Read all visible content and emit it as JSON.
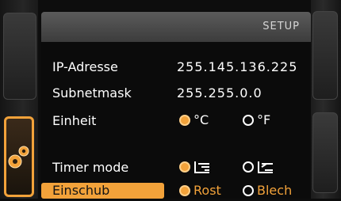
{
  "header": {
    "title": "SETUP"
  },
  "settings": {
    "ip": {
      "label": "IP-Adresse",
      "value": "255.145.136.225"
    },
    "subnet": {
      "label": "Subnetmask",
      "value": "255.255.0.0"
    },
    "unit": {
      "label": "Einheit",
      "options": [
        {
          "label": "°C",
          "selected": true
        },
        {
          "label": "°F",
          "selected": false
        }
      ]
    },
    "timer": {
      "label": "Timer mode",
      "options": [
        {
          "icon": "timer-mode-a-icon",
          "selected": true
        },
        {
          "icon": "timer-mode-b-icon",
          "selected": false
        }
      ]
    },
    "einschub": {
      "label": "Einschub",
      "options": [
        {
          "label": "Rost",
          "selected": true
        },
        {
          "label": "Blech",
          "selected": false
        }
      ]
    }
  },
  "colors": {
    "accent": "#f2a23a",
    "header": "#4a4a4a",
    "background": "#0b0b0b"
  },
  "side_tabs": {
    "active_icon": "settings-gears-icon"
  }
}
